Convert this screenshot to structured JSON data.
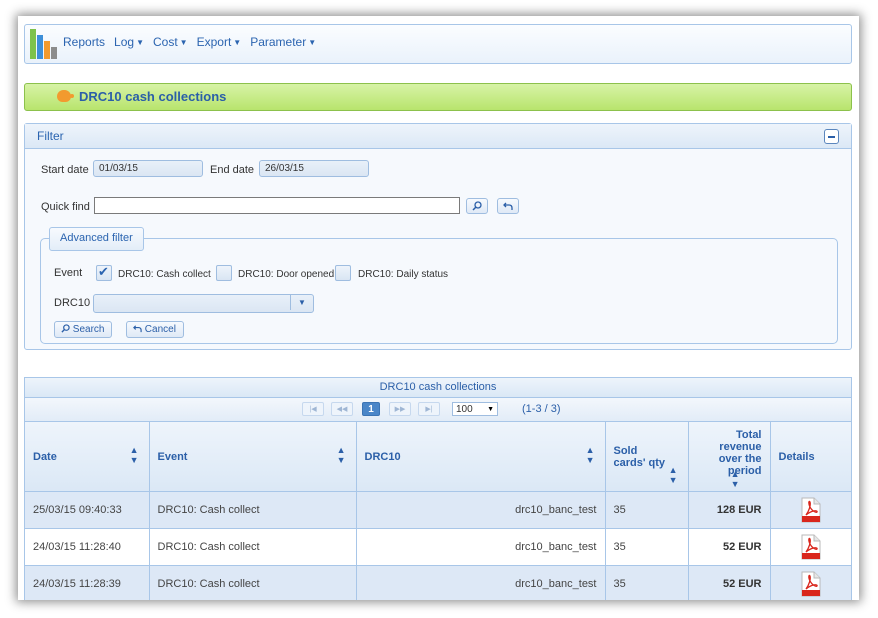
{
  "menu": {
    "items": [
      {
        "label": "Reports",
        "dropdown": false
      },
      {
        "label": "Log",
        "dropdown": true
      },
      {
        "label": "Cost",
        "dropdown": true
      },
      {
        "label": "Export",
        "dropdown": true
      },
      {
        "label": "Parameter",
        "dropdown": true
      }
    ]
  },
  "page": {
    "title": "DRC10 cash collections"
  },
  "filter": {
    "header": "Filter",
    "start_date_label": "Start date",
    "start_date": "01/03/15",
    "end_date_label": "End date",
    "end_date": "26/03/15",
    "quick_find_label": "Quick find",
    "quick_find_value": "",
    "advanced": {
      "legend": "Advanced filter",
      "event_label": "Event",
      "events": [
        {
          "label": "DRC10: Cash collect",
          "checked": true
        },
        {
          "label": "DRC10: Door opened",
          "checked": false
        },
        {
          "label": "DRC10: Daily status",
          "checked": false
        }
      ],
      "drc10_label": "DRC10",
      "drc10_value": "",
      "search_label": "Search",
      "cancel_label": "Cancel"
    }
  },
  "table": {
    "caption": "DRC10 cash collections",
    "pager": {
      "current_page": "1",
      "rows_per_page": "100",
      "count": "(1-3 / 3)"
    },
    "columns": [
      "Date",
      "Event",
      "DRC10",
      "Sold cards' qty",
      "Total revenue over the period",
      "Details"
    ],
    "rows": [
      {
        "date": "25/03/15 09:40:33",
        "event": "DRC10: Cash collect",
        "drc10": "drc10_banc_test",
        "qty": "35",
        "revenue": "128 EUR"
      },
      {
        "date": "24/03/15 11:28:40",
        "event": "DRC10: Cash collect",
        "drc10": "drc10_banc_test",
        "qty": "35",
        "revenue": "52 EUR"
      },
      {
        "date": "24/03/15 11:28:39",
        "event": "DRC10: Cash collect",
        "drc10": "drc10_banc_test",
        "qty": "35",
        "revenue": "52 EUR"
      }
    ]
  },
  "colors": {
    "accent": "#2b5fa8",
    "title_bar": "#b8e46d",
    "border": "#a8c6e8",
    "row_alt": "#dde8f6",
    "pdf_red": "#d9261c"
  },
  "icons": [
    "app-logo-icon",
    "piggy-bank-icon",
    "collapse-icon",
    "search-icon",
    "undo-icon",
    "checkbox-icon",
    "dropdown-arrow-icon",
    "sort-icon",
    "pdf-icon"
  ]
}
